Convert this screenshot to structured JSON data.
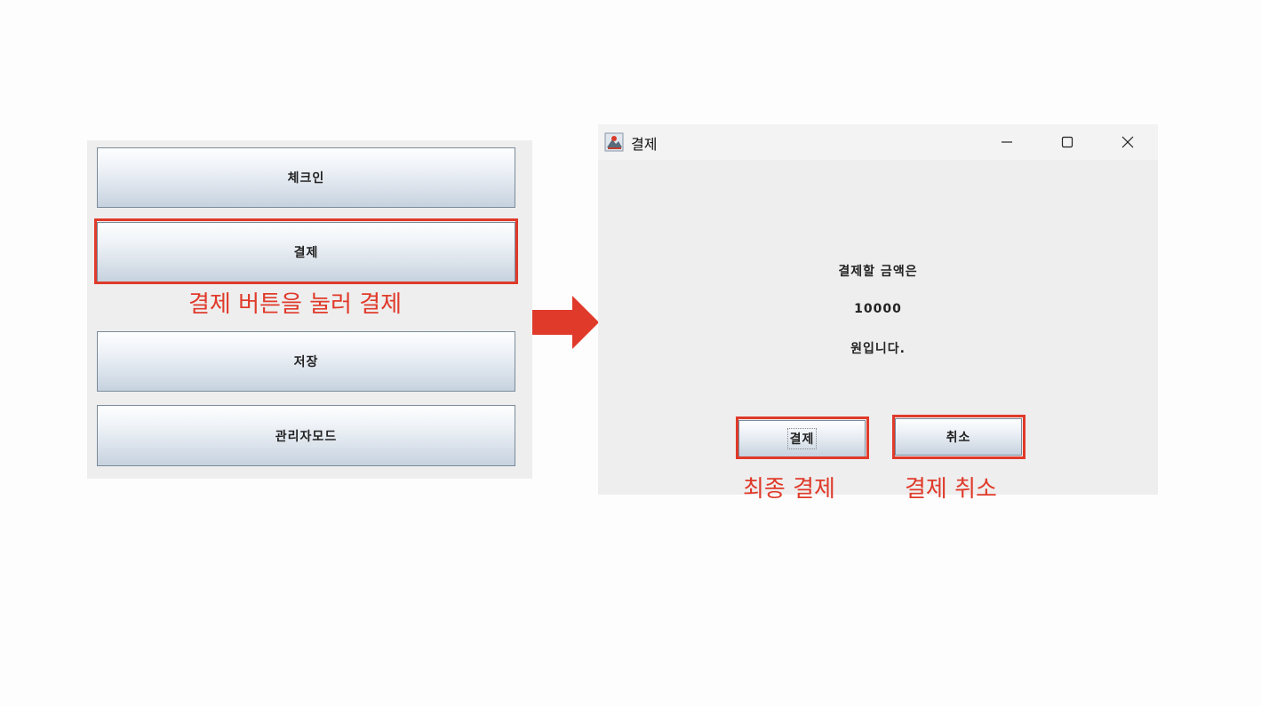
{
  "main_panel": {
    "buttons": [
      {
        "label": "체크인"
      },
      {
        "label": "결제"
      },
      {
        "label": "저장"
      },
      {
        "label": "관리자모드"
      }
    ],
    "annotation": "결제 버튼을 눌러 결제"
  },
  "dialog": {
    "title": "결제",
    "message_lines": [
      "결제할 금액은",
      "10000",
      "원입니다."
    ],
    "confirm_label": "결제",
    "cancel_label": "취소",
    "confirm_annotation": "최종 결제",
    "cancel_annotation": "결제 취소"
  },
  "colors": {
    "highlight": "#e03a2a",
    "panel_bg": "#eeeeee"
  },
  "icons": [
    "java-app-icon",
    "minimize-icon",
    "maximize-icon",
    "close-icon",
    "right-arrow-icon"
  ]
}
